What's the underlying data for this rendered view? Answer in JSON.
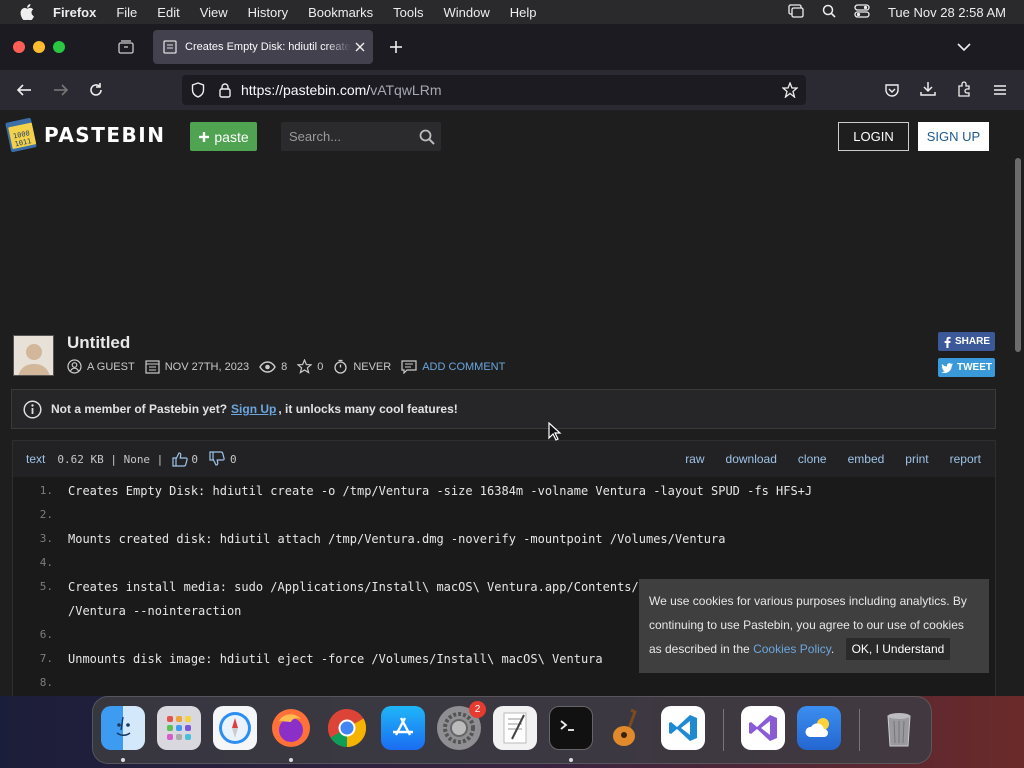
{
  "menubar": {
    "app": "Firefox",
    "items": [
      "File",
      "Edit",
      "View",
      "History",
      "Bookmarks",
      "Tools",
      "Window",
      "Help"
    ],
    "clock": "Tue Nov 28  2:58 AM"
  },
  "browser": {
    "tab_title": "Creates Empty Disk: hdiutil create",
    "url_host": "https://pastebin.com/",
    "url_path": "vATqwLRm"
  },
  "site": {
    "logo": "PASTEBIN",
    "paste_label": "paste",
    "search_placeholder": "Search...",
    "login_label": "LOGIN",
    "signup_label": "SIGN UP"
  },
  "post": {
    "title": "Untitled",
    "author": "A GUEST",
    "date": "NOV 27TH, 2023",
    "views": "8",
    "stars": "0",
    "expires": "NEVER",
    "add_comment": "ADD COMMENT",
    "share_label": "SHARE",
    "tweet_label": "TWEET"
  },
  "notice": {
    "prefix": "Not a member of Pastebin yet?",
    "link": "Sign Up",
    "suffix": ", it unlocks many cool features!"
  },
  "code": {
    "language": "text",
    "info": "0.62 KB | None |",
    "likes": "0",
    "dislikes": "0",
    "actions": [
      "raw",
      "download",
      "clone",
      "embed",
      "print",
      "report"
    ],
    "lines": [
      {
        "num": "1.",
        "text": "Creates Empty Disk: hdiutil create -o /tmp/Ventura -size 16384m -volname Ventura -layout SPUD -fs HFS+J"
      },
      {
        "num": "2.",
        "text": ""
      },
      {
        "num": "3.",
        "text": "Mounts created disk: hdiutil attach /tmp/Ventura.dmg -noverify -mountpoint /Volumes/Ventura"
      },
      {
        "num": "4.",
        "text": ""
      },
      {
        "num": "5.",
        "text": "Creates install media: sudo /Applications/Install\\ macOS\\ Ventura.app/Contents/"
      },
      {
        "num": "",
        "text": "/Ventura --nointeraction"
      },
      {
        "num": "6.",
        "text": ""
      },
      {
        "num": "7.",
        "text": "Unmounts disk image: hdiutil eject -force /Volumes/Install\\ macOS\\ Ventura"
      },
      {
        "num": "8.",
        "text": ""
      }
    ]
  },
  "cookie": {
    "text_before": "We use cookies for various purposes including analytics. By continuing to use Pastebin, you agree to our use of cookies as described in the",
    "link": "Cookies Policy",
    "text_after": ".",
    "ok_label": "OK, I Understand"
  },
  "dock": {
    "apps": [
      "finder-icon",
      "launchpad-icon",
      "safari-icon",
      "firefox-icon",
      "chrome-icon",
      "app-store-icon",
      "system-settings-icon",
      "textedit-icon",
      "terminal-icon",
      "garageband-icon",
      "vscode-icon",
      "visual-studio-icon",
      "weather-icon",
      "trash-icon"
    ],
    "settings_badge": "2"
  },
  "colors": {
    "paste_green": "#4fa351",
    "link_blue": "#6ba6de",
    "facebook": "#3b5998",
    "twitter": "#3a9ad9"
  }
}
